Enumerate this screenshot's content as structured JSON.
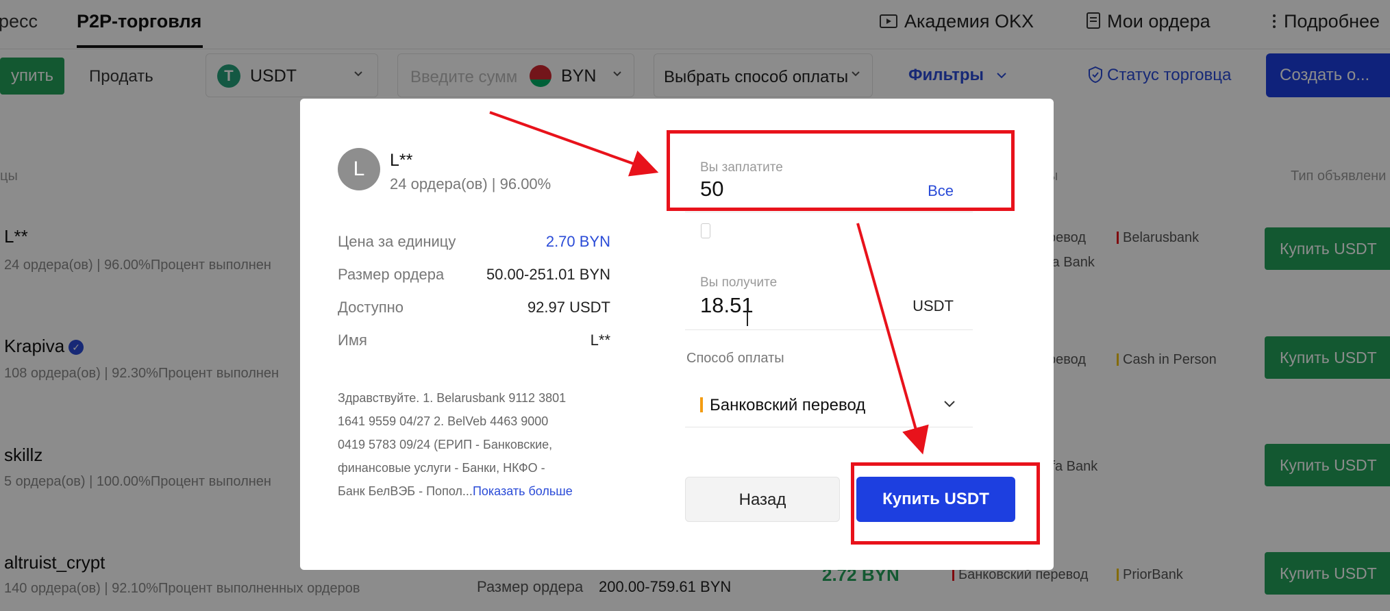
{
  "topnav": {
    "tab_express": "ресс",
    "tab_p2p": "P2P-торговля",
    "academy": "Академия OKX",
    "my_orders": "Мои ордера",
    "more": "Подробнее"
  },
  "filterbar": {
    "buy": "упить",
    "sell": "Продать",
    "coin": "USDT",
    "amount_placeholder": "Введите сумм",
    "fiat": "BYN",
    "payment_method": "Выбрать способ оплаты",
    "filters": "Фильтры",
    "merchant_status": "Статус торговца",
    "create_ad": "Создать о..."
  },
  "columns": {
    "left": "цы",
    "middle": "ы",
    "ad_type": "Тип объявлени"
  },
  "rows": [
    {
      "name": "L**",
      "meta": "24 ордера(ов)  |  96.00%Процент выполнен",
      "pay1": "ревод",
      "pay2": "Belarusbank",
      "pay3": "fa Bank",
      "buy": "Купить USDT"
    },
    {
      "name": "Krapiva",
      "meta": "108 ордера(ов)  |  92.30%Процент выполнен",
      "pay1": "ревод",
      "pay2": "Cash in Person",
      "buy": "Купить USDT"
    },
    {
      "name": "skillz",
      "meta": "5 ордера(ов)  |  100.00%Процент выполнен",
      "pay1": "lfa Bank",
      "buy": "Купить USDT"
    },
    {
      "name": "altruist_crypt",
      "meta": "140 ордера(ов)  |  92.10%Процент выполненных ордеров",
      "order_size_label": "Размер ордера",
      "order_size": "200.00-759.61 BYN",
      "price": "2.72 BYN",
      "pay1": "Банковский перевод",
      "pay2": "PriorBank",
      "buy": "Купить USDT"
    }
  ],
  "modal": {
    "avatar_letter": "L",
    "seller_name": "L**",
    "seller_stats": "24 ордера(ов) | 96.00%",
    "info": [
      {
        "label": "Цена за единицу",
        "value": "2.70 BYN"
      },
      {
        "label": "Размер ордера",
        "value": "50.00-251.01 BYN"
      },
      {
        "label": "Доступно",
        "value": "92.97 USDT"
      },
      {
        "label": "Имя",
        "value": "L**"
      }
    ],
    "terms_lines": [
      "Здравствуйте. 1. Belarusbank 9112 3801",
      "1641 9559 04/27 2. BelVeb 4463 9000",
      "0419 5783 09/24 (ЕРИП - Банковские,",
      "финансовые услуги - Банки, НКФО -"
    ],
    "terms_last": "Банк БелВЭБ - Попол...",
    "terms_more": "Показать больше",
    "pay_label": "Вы заплатите",
    "pay_value": "50",
    "pay_all": "Все",
    "get_label": "Вы получите",
    "get_value": "18.51",
    "get_unit": "USDT",
    "payment_method_label": "Способ оплаты",
    "payment_method_value": "Банковский перевод",
    "back": "Назад",
    "confirm": "Купить USDT"
  },
  "colors": {
    "buy_green": "#23a05a",
    "brand_blue": "#1d3fe0",
    "link_blue": "#2a4bd7",
    "annotation_red": "#e8121b",
    "payment_bar_orange": "#f39c12"
  }
}
